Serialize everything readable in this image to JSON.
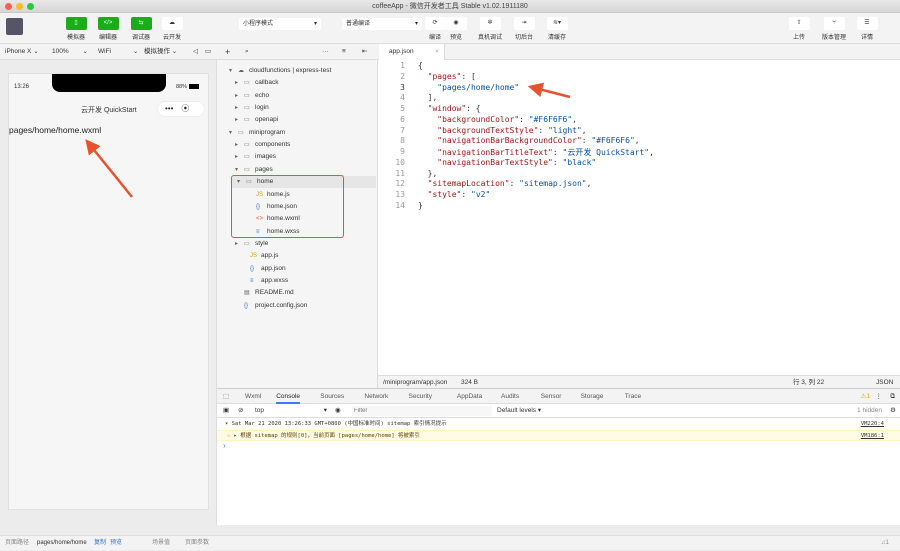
{
  "window": {
    "title": "coffeeApp - 微信开发者工具 Stable v1.02.1911180"
  },
  "toolbar": {
    "simulator": "模拟器",
    "editor": "编辑器",
    "debugger": "调试器",
    "cloud": "云开发",
    "mode": "小程序模式",
    "compile_mode": "普通编译",
    "compile": "编译",
    "preview": "预览",
    "remote_debug": "真机调试",
    "background": "切后台",
    "clear_cache": "清缓存",
    "upload": "上传",
    "version": "版本管理",
    "details": "详情",
    "accent": "#1AAD19"
  },
  "subbar": {
    "device": "iPhone X",
    "zoom": "100%",
    "network": "WiFi",
    "sim_ops": "模拟操作"
  },
  "phone": {
    "time": "13:26",
    "battery": "88%",
    "nav_title": "云开发 QuickStart",
    "content": "pages/home/home.wxml"
  },
  "tree": [
    {
      "label": "cloudfunctions | express-test",
      "icon": "cloud-folder-icon",
      "depth": 0,
      "open": true
    },
    {
      "label": "callback",
      "icon": "folder-icon",
      "depth": 1,
      "open": false
    },
    {
      "label": "echo",
      "icon": "folder-icon",
      "depth": 1,
      "open": false
    },
    {
      "label": "login",
      "icon": "folder-icon",
      "depth": 1,
      "open": false
    },
    {
      "label": "openapi",
      "icon": "folder-icon",
      "depth": 1,
      "open": false
    },
    {
      "label": "miniprogram",
      "icon": "folder-icon",
      "depth": 0,
      "open": true
    },
    {
      "label": "components",
      "icon": "folder-icon",
      "depth": 1,
      "open": false
    },
    {
      "label": "images",
      "icon": "folder-icon",
      "depth": 1,
      "open": false
    },
    {
      "label": "pages",
      "icon": "folder-icon",
      "depth": 1,
      "open": true
    },
    {
      "label": "home",
      "icon": "folder-icon",
      "depth": 2,
      "open": true
    },
    {
      "label": "home.js",
      "icon": "js-file-icon",
      "depth": 3
    },
    {
      "label": "home.json",
      "icon": "json-file-icon",
      "depth": 3
    },
    {
      "label": "home.wxml",
      "icon": "wxml-file-icon",
      "depth": 3
    },
    {
      "label": "home.wxss",
      "icon": "wxss-file-icon",
      "depth": 3
    },
    {
      "label": "style",
      "icon": "folder-icon",
      "depth": 1,
      "open": false
    },
    {
      "label": "app.js",
      "icon": "js-file-icon",
      "depth": 2
    },
    {
      "label": "app.json",
      "icon": "json-file-icon",
      "depth": 2
    },
    {
      "label": "app.wxss",
      "icon": "wxss-file-icon",
      "depth": 2
    },
    {
      "label": "README.md",
      "icon": "md-file-icon",
      "depth": 1
    },
    {
      "label": "project.config.json",
      "icon": "json-file-icon",
      "depth": 1
    }
  ],
  "editor": {
    "tab": "app.json",
    "lines": [
      [
        [
          "p",
          "{"
        ]
      ],
      [
        [
          "p",
          "  "
        ],
        [
          "k",
          "\"pages\""
        ],
        [
          "p",
          ": ["
        ]
      ],
      [
        [
          "p",
          "    "
        ],
        [
          "s",
          "\"pages/home/home\""
        ]
      ],
      [
        [
          "p",
          "  ],"
        ]
      ],
      [
        [
          "p",
          "  "
        ],
        [
          "k",
          "\"window\""
        ],
        [
          "p",
          ": {"
        ]
      ],
      [
        [
          "p",
          "    "
        ],
        [
          "k",
          "\"backgroundColor\""
        ],
        [
          "p",
          ": "
        ],
        [
          "s",
          "\"#F6F6F6\""
        ],
        [
          "p",
          ","
        ]
      ],
      [
        [
          "p",
          "    "
        ],
        [
          "k",
          "\"backgroundTextStyle\""
        ],
        [
          "p",
          ": "
        ],
        [
          "s",
          "\"light\""
        ],
        [
          "p",
          ","
        ]
      ],
      [
        [
          "p",
          "    "
        ],
        [
          "k",
          "\"navigationBarBackgroundColor\""
        ],
        [
          "p",
          ": "
        ],
        [
          "s",
          "\"#F6F6F6\""
        ],
        [
          "p",
          ","
        ]
      ],
      [
        [
          "p",
          "    "
        ],
        [
          "k",
          "\"navigationBarTitleText\""
        ],
        [
          "p",
          ": "
        ],
        [
          "s",
          "\"云开发 QuickStart\""
        ],
        [
          "p",
          ","
        ]
      ],
      [
        [
          "p",
          "    "
        ],
        [
          "k",
          "\"navigationBarTextStyle\""
        ],
        [
          "p",
          ": "
        ],
        [
          "s",
          "\"black\""
        ]
      ],
      [
        [
          "p",
          "  },"
        ]
      ],
      [
        [
          "p",
          "  "
        ],
        [
          "k",
          "\"sitemapLocation\""
        ],
        [
          "p",
          ": "
        ],
        [
          "s",
          "\"sitemap.json\""
        ],
        [
          "p",
          ","
        ]
      ],
      [
        [
          "p",
          "  "
        ],
        [
          "k",
          "\"style\""
        ],
        [
          "p",
          ": "
        ],
        [
          "s",
          "\"v2\""
        ]
      ],
      [
        [
          "p",
          "}"
        ]
      ]
    ],
    "status": {
      "path": "/miniprogram/app.json",
      "size": "324 B",
      "position": "行 3, 列 22",
      "lang": "JSON"
    }
  },
  "devtools": {
    "tabs": [
      "Wxml",
      "Console",
      "Sources",
      "Network",
      "Security",
      "AppData",
      "Audits",
      "Sensor",
      "Storage",
      "Trace"
    ],
    "active": "Console",
    "warn_count": "1",
    "context": "top",
    "filter_placeholder": "Filter",
    "levels": "Default levels ▾",
    "hidden": "1 hidden",
    "log1": "▾ Sat Mar 21 2020 13:26:33 GMT+0800 (中国标准时间) sitemap 索引情况提示",
    "log1_src": "VM220:4",
    "log2": "▸ 根据 sitemap 的规则[0]，当前页面 [pages/home/home] 将被索引",
    "log2_src": "VM186:1",
    "prompt": "›"
  },
  "bottom": {
    "path_label": "页面路径",
    "path": "pages/home/home",
    "copy": "复制",
    "preview": "预览",
    "scene": "场景值",
    "params": "页面参数",
    "notice": "1"
  }
}
